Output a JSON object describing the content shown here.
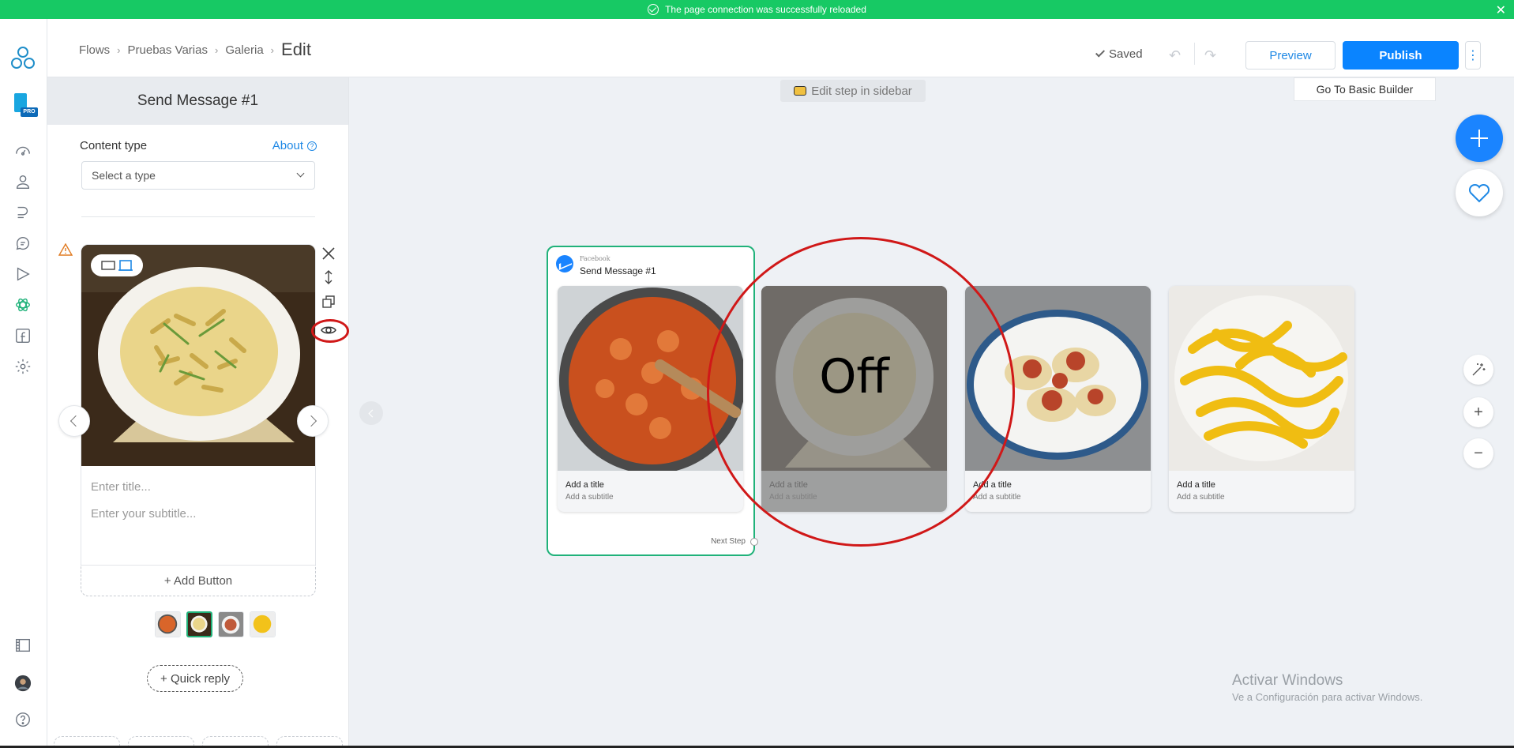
{
  "banner": {
    "message": "The page connection was successfully reloaded",
    "close": "✕"
  },
  "header": {
    "breadcrumbs": [
      "Flows",
      "Pruebas Varias",
      "Galeria"
    ],
    "current": "Edit",
    "saved_label": "Saved",
    "undo_icon": "↶",
    "redo_icon": "↷",
    "preview_label": "Preview",
    "publish_label": "Publish",
    "more_icon": "⋮",
    "basic_builder_label": "Go To Basic Builder"
  },
  "rail": {
    "icons": [
      "logo-icon",
      "pro-badge-icon",
      "dashboard-icon",
      "audience-icon",
      "automation-icon",
      "live-chat-icon",
      "broadcast-icon",
      "growth-tools-icon",
      "facebook-icon",
      "settings-icon",
      "templates-icon",
      "avatar",
      "help-icon"
    ],
    "pro_label": "PRO"
  },
  "sidebar": {
    "title": "Send Message #1",
    "content_type_label": "Content type",
    "about_label": "About",
    "about_icon": "?",
    "select_placeholder": "Select a type",
    "card": {
      "title_placeholder": "Enter title...",
      "subtitle_placeholder": "Enter your subtitle..."
    },
    "add_button_label": "+ Add Button",
    "quick_reply_label": "+ Quick reply",
    "thumbnails": [
      "fusilli",
      "penne",
      "ravioli",
      "tagliatelle"
    ],
    "selected_thumbnail": 1
  },
  "canvas": {
    "hint": "Edit step in sidebar",
    "node": {
      "source": "Facebook",
      "name": "Send Message #1",
      "next_step": "Next Step"
    },
    "cards": [
      {
        "title": "Add a title",
        "subtitle": "Add a subtitle",
        "off": false
      },
      {
        "title": "Add a title",
        "subtitle": "Add a subtitle",
        "off": true,
        "off_label": "Off"
      },
      {
        "title": "Add a title",
        "subtitle": "Add a subtitle",
        "off": false
      },
      {
        "title": "Add a title",
        "subtitle": "Add a subtitle",
        "off": false
      }
    ],
    "zoom_plus": "+",
    "zoom_minus": "−"
  },
  "watermark": {
    "line1": "Activar Windows",
    "line2": "Ve a Configuración para activar Windows."
  },
  "colors": {
    "banner": "#17c964",
    "accent": "#0a84ff",
    "node_border": "#20b27a",
    "annotation": "#d01818"
  }
}
